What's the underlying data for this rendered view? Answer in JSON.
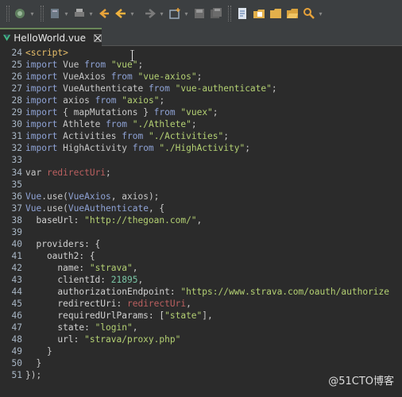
{
  "tab": {
    "title": "HelloWorld.vue"
  },
  "toolbar": {
    "icons": [
      "new-icon",
      "save-icon",
      "save-all-icon",
      "print-icon",
      "build-icon",
      "run-icon",
      "back-icon",
      "forward-icon",
      "new-window-icon",
      "file-icon",
      "folder-icon",
      "open-folder-icon",
      "search-icon"
    ]
  },
  "editor": {
    "lines": [
      {
        "n": "24",
        "t": [
          [
            "tag",
            "<script>"
          ]
        ]
      },
      {
        "n": "25",
        "t": [
          [
            "kw",
            "import"
          ],
          [
            "plain",
            " Vue "
          ],
          [
            "kw",
            "from"
          ],
          [
            "plain",
            " "
          ],
          [
            "str",
            "\"vue\""
          ],
          [
            "plain",
            ";"
          ]
        ]
      },
      {
        "n": "26",
        "t": [
          [
            "kw",
            "import"
          ],
          [
            "plain",
            " VueAxios "
          ],
          [
            "kw",
            "from"
          ],
          [
            "plain",
            " "
          ],
          [
            "str",
            "\"vue-axios\""
          ],
          [
            "plain",
            ";"
          ]
        ]
      },
      {
        "n": "27",
        "t": [
          [
            "kw",
            "import"
          ],
          [
            "plain",
            " VueAuthenticate "
          ],
          [
            "kw",
            "from"
          ],
          [
            "plain",
            " "
          ],
          [
            "str",
            "\"vue-authenticate\""
          ],
          [
            "plain",
            ";"
          ]
        ]
      },
      {
        "n": "28",
        "t": [
          [
            "kw",
            "import"
          ],
          [
            "plain",
            " axios "
          ],
          [
            "kw",
            "from"
          ],
          [
            "plain",
            " "
          ],
          [
            "str",
            "\"axios\""
          ],
          [
            "plain",
            ";"
          ]
        ]
      },
      {
        "n": "29",
        "t": [
          [
            "kw",
            "import"
          ],
          [
            "plain",
            " { mapMutations } "
          ],
          [
            "kw",
            "from"
          ],
          [
            "plain",
            " "
          ],
          [
            "str",
            "\"vuex\""
          ],
          [
            "plain",
            ";"
          ]
        ]
      },
      {
        "n": "30",
        "t": [
          [
            "kw",
            "import"
          ],
          [
            "plain",
            " Athlete "
          ],
          [
            "kw",
            "from"
          ],
          [
            "plain",
            " "
          ],
          [
            "str",
            "\"./Athlete\""
          ],
          [
            "plain",
            ";"
          ]
        ]
      },
      {
        "n": "31",
        "t": [
          [
            "kw",
            "import"
          ],
          [
            "plain",
            " Activities "
          ],
          [
            "kw",
            "from"
          ],
          [
            "plain",
            " "
          ],
          [
            "str",
            "\"./Activities\""
          ],
          [
            "plain",
            ";"
          ]
        ]
      },
      {
        "n": "32",
        "t": [
          [
            "kw",
            "import"
          ],
          [
            "plain",
            " HighActivity "
          ],
          [
            "kw",
            "from"
          ],
          [
            "plain",
            " "
          ],
          [
            "str",
            "\"./HighActivity\""
          ],
          [
            "plain",
            ";"
          ]
        ]
      },
      {
        "n": "33",
        "t": []
      },
      {
        "n": "34",
        "t": [
          [
            "plain",
            "var "
          ],
          [
            "id",
            "redirectUri"
          ],
          [
            "plain",
            ";"
          ]
        ]
      },
      {
        "n": "35",
        "t": []
      },
      {
        "n": "36",
        "t": [
          [
            "kw",
            "Vue"
          ],
          [
            "plain",
            ".use("
          ],
          [
            "kw",
            "VueAxios"
          ],
          [
            "plain",
            ", axios);"
          ]
        ]
      },
      {
        "n": "37",
        "t": [
          [
            "kw",
            "Vue"
          ],
          [
            "plain",
            ".use("
          ],
          [
            "kw",
            "VueAuthenticate"
          ],
          [
            "plain",
            ", {"
          ]
        ]
      },
      {
        "n": "38",
        "t": [
          [
            "prop",
            "  baseUrl: "
          ],
          [
            "str",
            "\"http://thegoan.com/\""
          ],
          [
            "plain",
            ","
          ]
        ]
      },
      {
        "n": "39",
        "t": []
      },
      {
        "n": "40",
        "t": [
          [
            "prop",
            "  providers: {"
          ]
        ]
      },
      {
        "n": "41",
        "t": [
          [
            "prop",
            "    oauth2: {"
          ]
        ]
      },
      {
        "n": "42",
        "t": [
          [
            "prop",
            "      name: "
          ],
          [
            "str",
            "\"strava\""
          ],
          [
            "plain",
            ","
          ]
        ]
      },
      {
        "n": "43",
        "t": [
          [
            "prop",
            "      clientId: "
          ],
          [
            "num",
            "21895"
          ],
          [
            "plain",
            ","
          ]
        ]
      },
      {
        "n": "44",
        "t": [
          [
            "prop",
            "      authorizationEndpoint: "
          ],
          [
            "str",
            "\"https://www.strava.com/oauth/authorize"
          ]
        ]
      },
      {
        "n": "45",
        "t": [
          [
            "prop",
            "      redirectUri: "
          ],
          [
            "id",
            "redirectUri"
          ],
          [
            "plain",
            ","
          ]
        ]
      },
      {
        "n": "46",
        "t": [
          [
            "prop",
            "      requiredUrlParams: ["
          ],
          [
            "str",
            "\"state\""
          ],
          [
            "plain",
            "],"
          ]
        ]
      },
      {
        "n": "47",
        "t": [
          [
            "prop",
            "      state: "
          ],
          [
            "str",
            "\"login\""
          ],
          [
            "plain",
            ","
          ]
        ]
      },
      {
        "n": "48",
        "t": [
          [
            "prop",
            "      url: "
          ],
          [
            "str",
            "\"strava/proxy.php\""
          ]
        ]
      },
      {
        "n": "49",
        "t": [
          [
            "plain",
            "    }"
          ]
        ]
      },
      {
        "n": "50",
        "t": [
          [
            "plain",
            "  }"
          ]
        ]
      },
      {
        "n": "51",
        "t": [
          [
            "plain",
            "});"
          ]
        ]
      }
    ]
  },
  "watermark": "@51CTO博客",
  "colors": {
    "background": "#2b2b2b",
    "keyword": "#8fa3d6",
    "string": "#b4d173",
    "number": "#7ac5a5",
    "identifier": "#bc6060"
  }
}
